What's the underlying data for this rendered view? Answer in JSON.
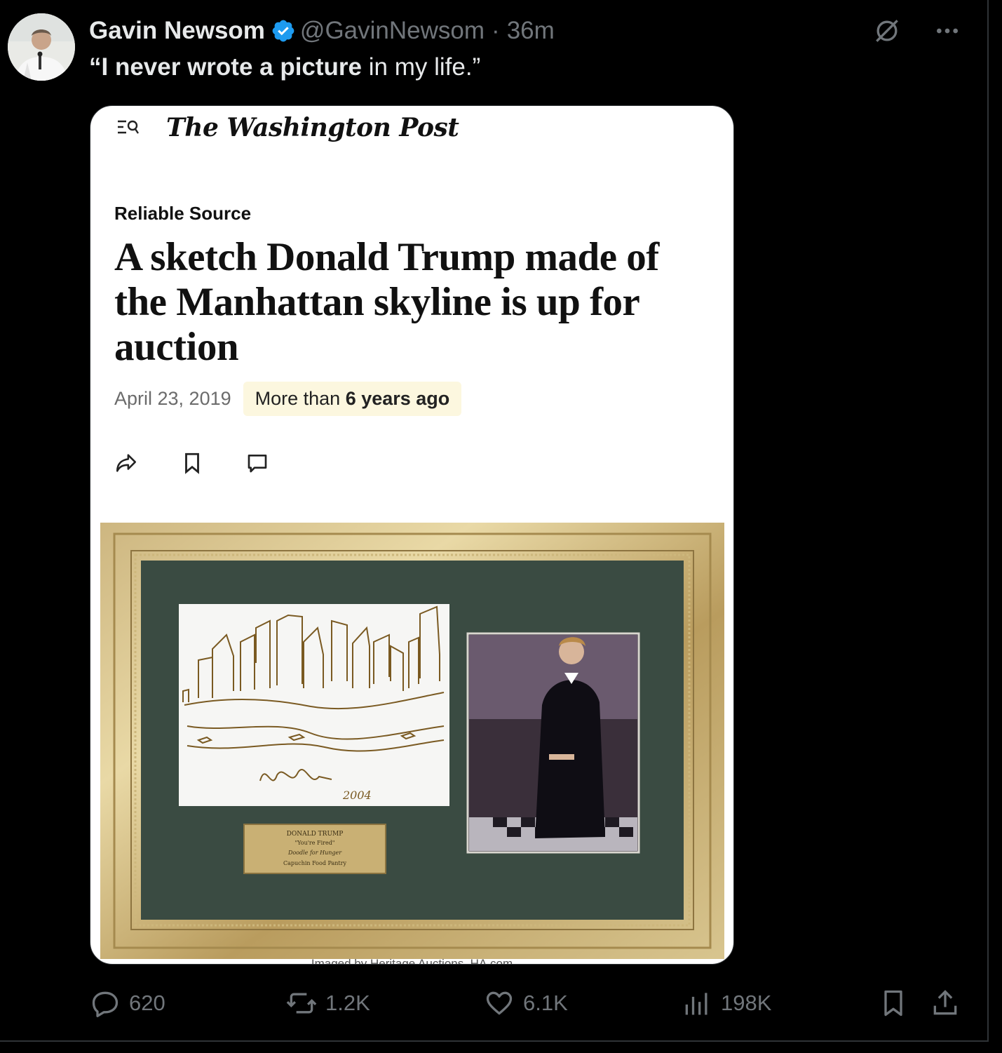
{
  "tweet": {
    "display_name": "Gavin Newsom",
    "handle": "@GavinNewsom",
    "separator": "·",
    "time": "36m",
    "text_bold_1": "“I never wrote a picture",
    "text_rest": " in my life.”",
    "verified_color": "#1d9bf0"
  },
  "article": {
    "publication": "The Washington Post",
    "kicker": "Reliable Source",
    "headline": "A sketch Donald Trump made of the Manhattan skyline is up for auction",
    "date": "April 23, 2019",
    "age_prefix": "More than ",
    "age_bold": "6 years ago",
    "photo_credit": "Imaged by Heritage Auctions, HA.com",
    "plaque": {
      "line1": "DONALD TRUMP",
      "line2": "\"You're Fired\"",
      "line3": "Doodle for Hunger",
      "line4": "Capuchin Food Pantry"
    },
    "sketch_year": "2004"
  },
  "actions": {
    "replies": "620",
    "reposts": "1.2K",
    "likes": "6.1K",
    "views": "198K"
  },
  "icons": [
    "grok-icon",
    "more-icon",
    "verified-badge-icon",
    "menu-search-icon",
    "share-icon",
    "bookmark-icon",
    "comment-icon",
    "reply-icon",
    "repost-icon",
    "like-icon",
    "views-icon",
    "share-upload-icon"
  ]
}
